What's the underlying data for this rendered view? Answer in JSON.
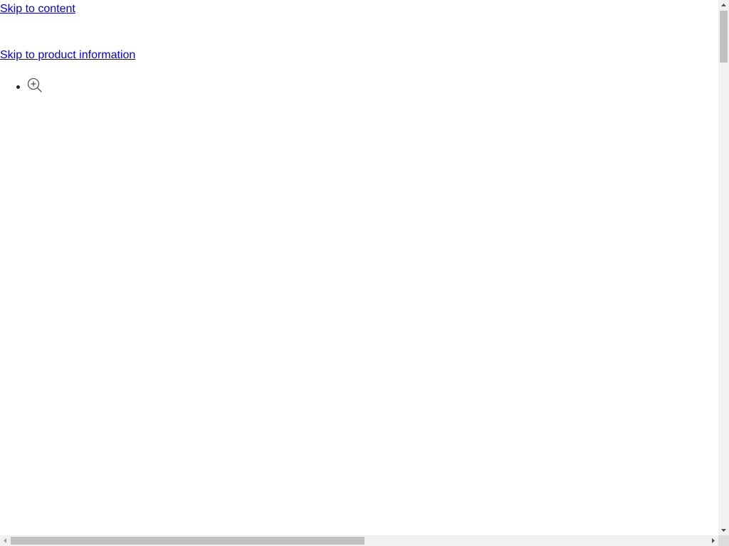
{
  "links": {
    "skip_content": "Skip to content",
    "skip_product": "Skip to product information"
  },
  "gallery": {
    "items": [
      {
        "icon": "zoom-in-icon"
      }
    ]
  },
  "scrollbars": {
    "vertical": {
      "position_fraction": 0.0,
      "visible_fraction": 0.1
    },
    "horizontal": {
      "position_fraction": 0.0,
      "visible_fraction": 0.5
    }
  },
  "colors": {
    "link": "#0000ee",
    "icon": "#555555",
    "scrollbar_track": "#f1f1f1",
    "scrollbar_thumb": "#c1c1c1"
  }
}
